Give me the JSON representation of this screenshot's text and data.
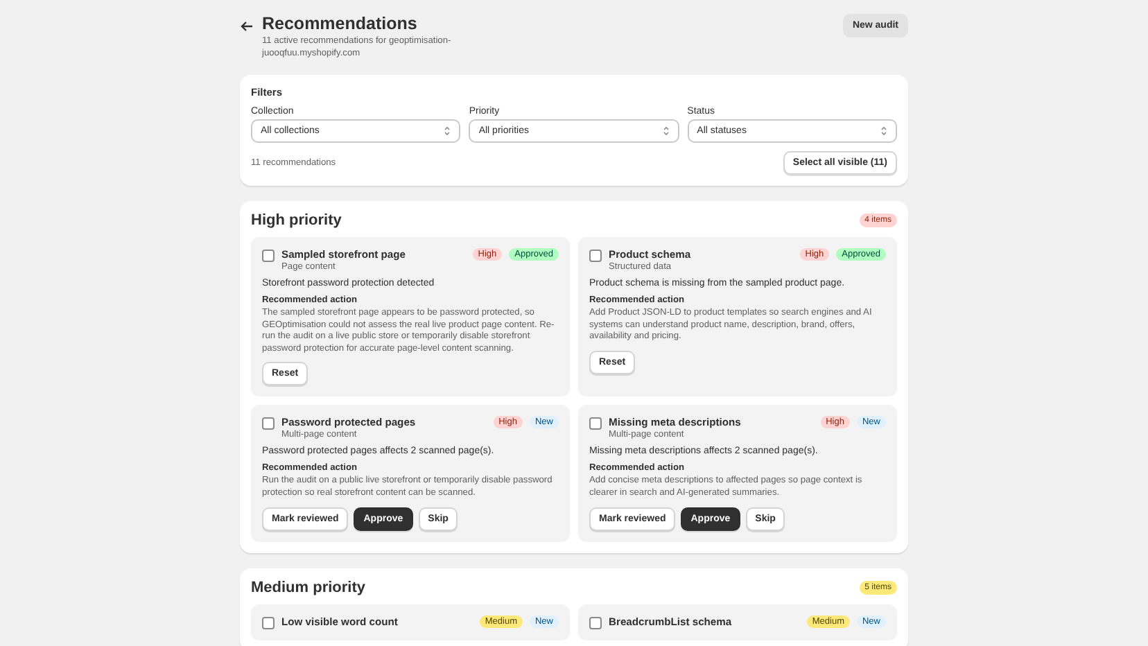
{
  "header": {
    "title": "Recommendations",
    "subtitle": "11 active recommendations for geoptimisation-juooqfuu.myshopify.com",
    "button": "New audit"
  },
  "filters": {
    "title": "Filters",
    "selects": [
      {
        "label": "Collection",
        "value": "All collections"
      },
      {
        "label": "Priority",
        "value": "All priorities"
      },
      {
        "label": "Status",
        "value": "All statuses"
      }
    ],
    "count": "11 recommendations",
    "select_all": "Select all visible (11)"
  },
  "sections": [
    {
      "title": "High priority",
      "count": "4 items",
      "kind": "high",
      "cards": [
        {
          "title": "Sampled storefront page",
          "category": "Page content",
          "checked": false,
          "priority": {
            "label": "High",
            "kind": "high"
          },
          "status": {
            "label": "Approved",
            "kind": "approved"
          },
          "summary": "Storefront password protection detected",
          "action_label": "Recommended action",
          "action": "The sampled storefront page appears to be password protected, so GEOptimisation could not assess the real live product page content. Re-run the audit on a live public store or temporarily disable storefront password protection for accurate page-level content scanning.",
          "buttons": [
            {
              "label": "Reset",
              "kind": "secondary"
            }
          ]
        },
        {
          "title": "Product schema",
          "category": "Structured data",
          "checked": false,
          "priority": {
            "label": "High",
            "kind": "high"
          },
          "status": {
            "label": "Approved",
            "kind": "approved"
          },
          "summary": "Product schema is missing from the sampled product page.",
          "action_label": "Recommended action",
          "action": "Add Product JSON-LD to product templates so search engines and AI systems can understand product name, description, brand, offers, availability and pricing.",
          "buttons": [
            {
              "label": "Reset",
              "kind": "secondary"
            }
          ]
        },
        {
          "title": "Password protected pages",
          "category": "Multi-page content",
          "checked": false,
          "priority": {
            "label": "High",
            "kind": "high"
          },
          "status": {
            "label": "New",
            "kind": "new"
          },
          "summary": "Password protected pages affects 2 scanned page(s).",
          "action_label": "Recommended action",
          "action": "Run the audit on a public live storefront or temporarily disable password protection so real storefront content can be scanned.",
          "buttons": [
            {
              "label": "Mark reviewed",
              "kind": "secondary"
            },
            {
              "label": "Approve",
              "kind": "primary"
            },
            {
              "label": "Skip",
              "kind": "secondary"
            }
          ]
        },
        {
          "title": "Missing meta descriptions",
          "category": "Multi-page content",
          "checked": false,
          "priority": {
            "label": "High",
            "kind": "high"
          },
          "status": {
            "label": "New",
            "kind": "new"
          },
          "summary": "Missing meta descriptions affects 2 scanned page(s).",
          "action_label": "Recommended action",
          "action": "Add concise meta descriptions to affected pages so page context is clearer in search and AI-generated summaries.",
          "buttons": [
            {
              "label": "Mark reviewed",
              "kind": "secondary"
            },
            {
              "label": "Approve",
              "kind": "primary"
            },
            {
              "label": "Skip",
              "kind": "secondary"
            }
          ]
        }
      ]
    },
    {
      "title": "Medium priority",
      "count": "5 items",
      "kind": "medium",
      "cards": [
        {
          "title": "Low visible word count",
          "checked": false,
          "priority": {
            "label": "Medium",
            "kind": "medium"
          },
          "status": {
            "label": "New",
            "kind": "new"
          }
        },
        {
          "title": "BreadcrumbList schema",
          "checked": false,
          "priority": {
            "label": "Medium",
            "kind": "medium"
          },
          "status": {
            "label": "New",
            "kind": "new"
          }
        }
      ]
    }
  ]
}
